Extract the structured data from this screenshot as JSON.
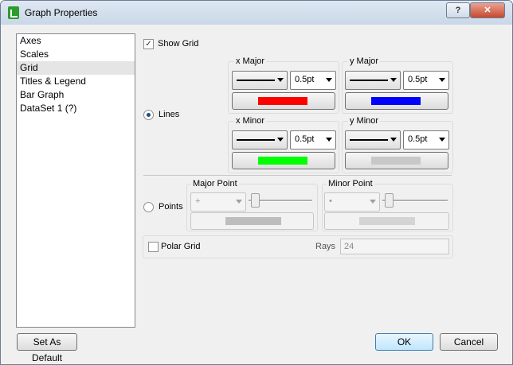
{
  "window": {
    "title": "Graph Properties",
    "help_label": "?",
    "close_label": "✕"
  },
  "nav": {
    "items": [
      "Axes",
      "Scales",
      "Grid",
      "Titles & Legend",
      "Bar Graph",
      "DataSet 1 (?)"
    ],
    "selected": "Grid"
  },
  "grid": {
    "show_grid_label": "Show Grid",
    "show_grid_checked": true,
    "lines_label": "Lines",
    "lines_selected": true,
    "x_major": {
      "label": "x Major",
      "width": "0.5pt",
      "color": "#ff0000"
    },
    "y_major": {
      "label": "y Major",
      "width": "0.5pt",
      "color": "#0000ff"
    },
    "x_minor": {
      "label": "x Minor",
      "width": "0.5pt",
      "color": "#00ff00"
    },
    "y_minor": {
      "label": "y Minor",
      "width": "0.5pt",
      "color": "#c8c8c8"
    },
    "points_label": "Points",
    "points_selected": false,
    "major_point": {
      "label": "Major Point",
      "symbol": "+"
    },
    "minor_point": {
      "label": "Minor Point",
      "symbol": "•"
    },
    "polar_label": "Polar Grid",
    "polar_checked": false,
    "rays_label": "Rays",
    "rays_value": "24"
  },
  "footer": {
    "set_default_label": "Set As Default",
    "ok_label": "OK",
    "cancel_label": "Cancel"
  },
  "icons": {
    "check": "✓",
    "app": "graph-icon"
  }
}
